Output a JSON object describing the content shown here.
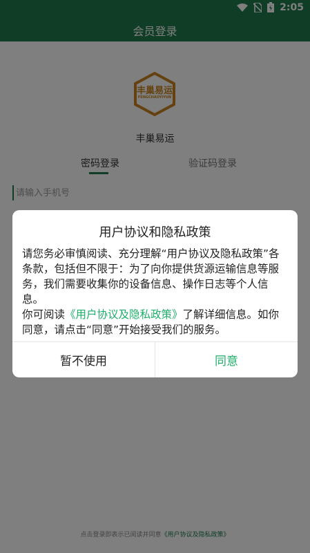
{
  "status_bar": {
    "time": "2:05",
    "icons": [
      "wifi-icon",
      "no-sim-icon",
      "battery-icon"
    ]
  },
  "app_bar": {
    "title": "会员登录"
  },
  "logo": {
    "text_cn": "丰巢易运",
    "text_en": "FENGCHAOYIYUN"
  },
  "brand_name": "丰巢易运",
  "tabs": [
    {
      "label": "密码登录",
      "active": true
    },
    {
      "label": "验证码登录",
      "active": false
    }
  ],
  "phone_input": {
    "placeholder": "请输入手机号"
  },
  "footer": {
    "text": "点击登录即表示已阅读并同意",
    "link": "《用户协议及隐私政策》"
  },
  "dialog": {
    "title": "用户协议和隐私政策",
    "paragraph1": "请您务必审慎阅读、充分理解“用户协议及隐私政策”各条款，包括但不限于：为了向你提供货源运输信息等服务，我们需要收集你的设备信息、操作日志等个人信息。",
    "paragraph2_prefix": "你可阅读",
    "paragraph2_link": "《用户协议及隐私政策》",
    "paragraph2_suffix": "了解详细信息。如你同意，请点击“同意”开始接受我们的服务。",
    "reject_label": "暂不使用",
    "agree_label": "同意"
  },
  "colors": {
    "primary": "#1f7a4d",
    "accent_link": "#1fae6a",
    "logo_gold": "#c8821c"
  }
}
